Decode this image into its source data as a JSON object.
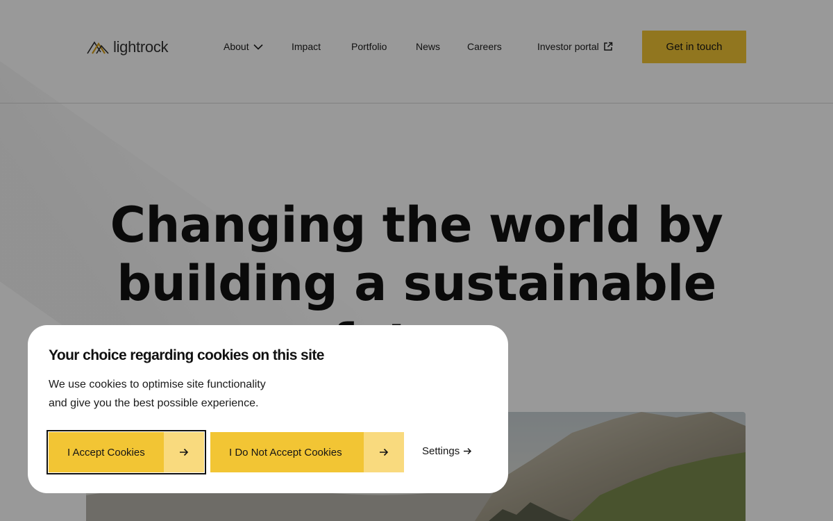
{
  "header": {
    "logo_text": "lightrock",
    "nav": [
      {
        "label": "About",
        "icon": "chevron-down-icon"
      },
      {
        "label": "Impact"
      },
      {
        "label": "Portfolio"
      },
      {
        "label": "News"
      },
      {
        "label": "Careers"
      },
      {
        "label": "Investor portal",
        "icon": "external-link-icon"
      }
    ],
    "cta_label": "Get in touch"
  },
  "hero": {
    "title_line1": "Changing the world by",
    "title_line2": "building a sustainable",
    "title_line3": "future"
  },
  "cookie_banner": {
    "title": "Your choice regarding cookies on this site",
    "text_line1": "We use cookies to optimise site functionality",
    "text_line2": "and give you the best possible experience.",
    "accept_label": "I Accept Cookies",
    "decline_label": "I Do Not Accept Cookies",
    "settings_label": "Settings"
  },
  "colors": {
    "accent": "#f2c534",
    "accent_light": "#f9da7e",
    "overlay": "rgba(0,0,0,0.40)"
  }
}
